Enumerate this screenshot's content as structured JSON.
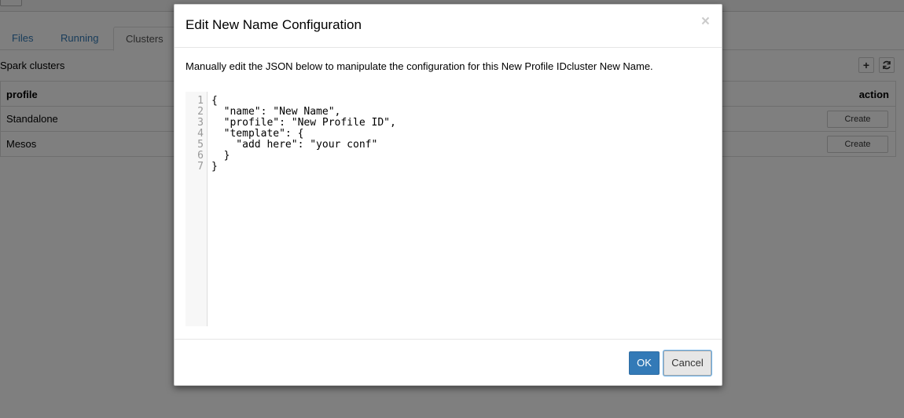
{
  "app": {
    "tabs": [
      {
        "label": "Files"
      },
      {
        "label": "Running"
      },
      {
        "label": "Clusters"
      }
    ],
    "clusters_title": "Spark clusters",
    "toolbar": {
      "add_icon": "plus-icon",
      "refresh_icon": "refresh-icon"
    },
    "table": {
      "headers": {
        "profile": "profile",
        "action": "action"
      },
      "rows": [
        {
          "profile": "Standalone",
          "action": "Create"
        },
        {
          "profile": "Mesos",
          "action": "Create"
        }
      ]
    }
  },
  "modal": {
    "title": "Edit New Name Configuration",
    "close": "×",
    "description": "Manually edit the JSON below to manipulate the configuration for this New Profile IDcluster New Name.",
    "editor": {
      "line_numbers": [
        "1",
        "2",
        "3",
        "4",
        "5",
        "6",
        "7"
      ],
      "lines": [
        "{",
        "  \"name\": \"New Name\",",
        "  \"profile\": \"New Profile ID\",",
        "  \"template\": {",
        "    \"add here\": \"your conf\"",
        "  }",
        "}"
      ]
    },
    "ok_label": "OK",
    "cancel_label": "Cancel"
  },
  "colors": {
    "primary": "#337ab7",
    "link": "#337ab7",
    "backdrop": "#000000"
  }
}
